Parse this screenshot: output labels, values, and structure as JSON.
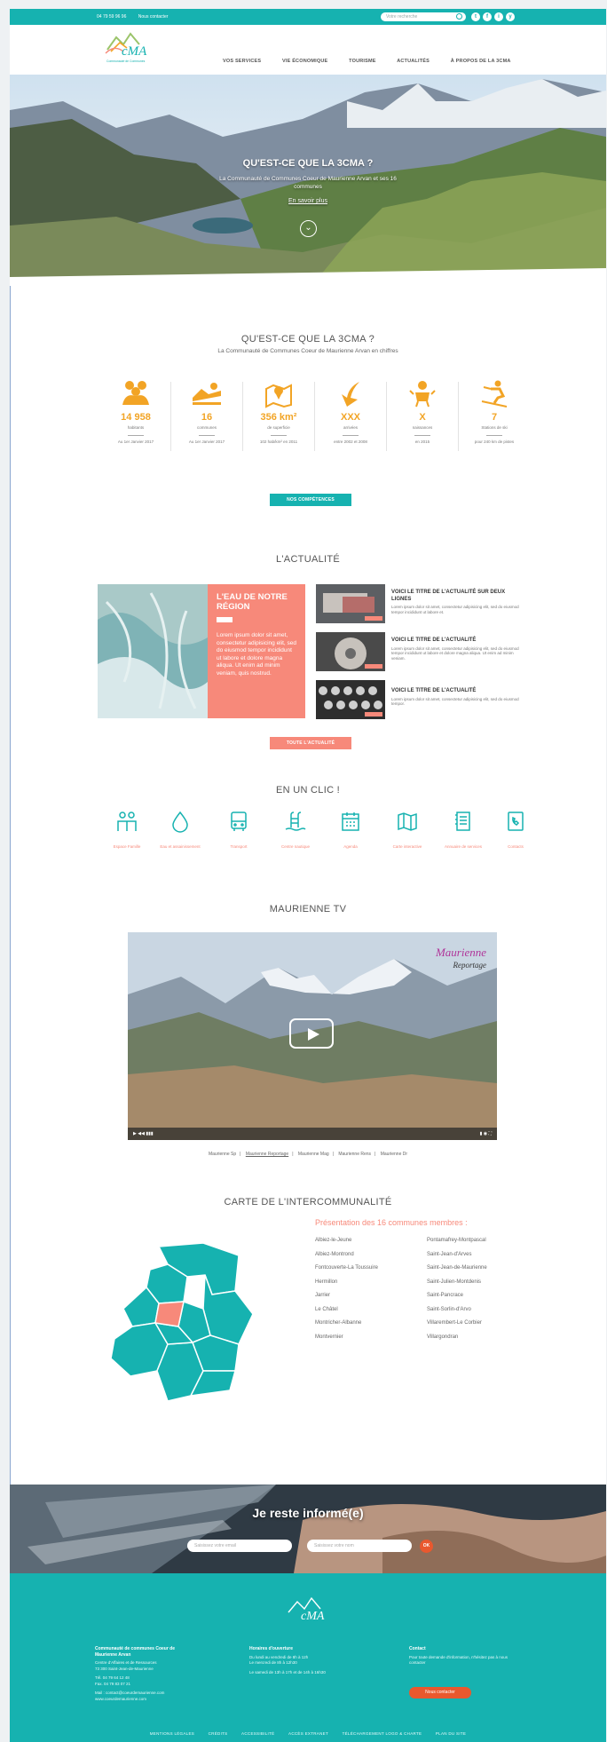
{
  "topbar": {
    "phone": "04 79 59 96 96",
    "contact": "Nous contacter",
    "search_placeholder": "Votre recherche",
    "social": [
      "t",
      "f",
      "i",
      "y"
    ]
  },
  "nav": [
    "VOS SERVICES",
    "VIE ÉCONOMIQUE",
    "TOURISME",
    "ACTUALITÉS",
    "À PROPOS DE LA 3CMA"
  ],
  "logo": {
    "text": "3CMA",
    "tagline": "Communauté de Communes"
  },
  "hero": {
    "title": "QU'EST-CE QUE LA 3CMA ?",
    "subtitle": "La Communauté de Communes Coeur de Maurienne Arvan et ses 16 communes",
    "link": "En savoir plus"
  },
  "about": {
    "title": "QU'EST-CE QUE LA 3CMA ?",
    "subtitle": "La Communauté de Communes Coeur de Maurienne Arvan en chiffres"
  },
  "stats": [
    {
      "icon": "people-icon",
      "value": "14 958",
      "label": "habitants",
      "note": "Au 1er Janvier 2017"
    },
    {
      "icon": "landscape-icon",
      "value": "16",
      "label": "communes",
      "note": "Au 1er Janvier 2017"
    },
    {
      "icon": "map-pin-icon",
      "value": "356 km²",
      "label": "de superficie",
      "note": "102 hab/km² en 2011"
    },
    {
      "icon": "arrow-down-icon",
      "value": "XXX",
      "label": "arrivées",
      "note": "entre 2002 et 2008"
    },
    {
      "icon": "baby-icon",
      "value": "X",
      "label": "naissances",
      "note": "en 2015"
    },
    {
      "icon": "skier-icon",
      "value": "7",
      "label": "Stations de ski",
      "note": "pour 240 km de pistes"
    }
  ],
  "competences_button": "NOS COMPÉTENCES",
  "news": {
    "title": "L'ACTUALITÉ",
    "main_title": "L'EAU DE NOTRE RÉGION",
    "main_text": "Lorem ipsum dolor sit amet, consectetur adipisicing elit, sed do eiusmod tempor incididunt ut labore et dolore magna aliqua. Ut enim ad minim veniam, quis nostrud.",
    "items": [
      {
        "title": "VOICI LE TITRE DE L'ACTUALITÉ SUR DEUX LIGNES",
        "text": "Lorem ipsum dolor sit amet, consectetur adipisicing elit, sed do eiusmod tempor incididunt ut labore et."
      },
      {
        "title": "VOICI LE TITRE DE L'ACTUALITÉ",
        "text": "Lorem ipsum dolor sit amet, consectetur adipisicing elit, sed do eiusmod tempor incididunt ut labore et dolore magna aliqua. Ut enim ad minim veniam."
      },
      {
        "title": "VOICI LE TITRE DE L'ACTUALITÉ",
        "text": "Lorem ipsum dolor sit amet, consectetur adipisicing elit, sed do eiusmod tempor."
      }
    ],
    "all_button": "TOUTE L'ACTUALITÉ"
  },
  "clic": {
    "title": "EN UN CLIC !",
    "items": [
      {
        "icon": "family-icon",
        "label": "Espace Famille"
      },
      {
        "icon": "water-drop-icon",
        "label": "Eau et assainissement"
      },
      {
        "icon": "bus-icon",
        "label": "Transport"
      },
      {
        "icon": "pool-icon",
        "label": "Centre nautique"
      },
      {
        "icon": "calendar-icon",
        "label": "Agenda"
      },
      {
        "icon": "map-icon",
        "label": "Carte interactive"
      },
      {
        "icon": "directory-icon",
        "label": "Annuaire de services"
      },
      {
        "icon": "phone-icon",
        "label": "Contacts"
      }
    ]
  },
  "tv": {
    "title": "MAURIENNE TV",
    "brand": "Maurienne",
    "brand2": "Reportage",
    "links": [
      "Maurienne Sp",
      "Maurienne Reportage",
      "Maurienne Mag",
      "Maurienne Rens",
      "Maurienne Dr"
    ]
  },
  "map": {
    "title": "CARTE DE L'INTERCOMMUNALITÉ",
    "heading": "Présentation des 16 communes membres :",
    "left": [
      "Albiez-le-Jeune",
      "Albiez-Montrond",
      "Fontcouverte-La Toussuire",
      "Hermillon",
      "Jarrier",
      "Le Châtel",
      "Montricher-Albanne",
      "Montvernier"
    ],
    "right": [
      "Pontamafrey-Montpascal",
      "Saint-Jean-d'Arves",
      "Saint-Jean-de-Maurienne",
      "Saint-Julien-Montdenis",
      "Saint-Pancrace",
      "Saint-Sorlin-d'Arvo",
      "Villarembert-Le Corbier",
      "Villargondran"
    ]
  },
  "newsletter": {
    "title": "Je reste informé(e)",
    "email_placeholder": "Saisissez votre email",
    "name_placeholder": "Saisissez votre nom",
    "ok": "OK"
  },
  "footer": {
    "col1": {
      "h": "Communauté de communes Coeur de Maurienne Arvan",
      "lines": [
        "Centre d'Affaires et de Ressources",
        "73 300 Saint-Jean-de-Maurienne",
        "Tél. 04 79 64 12 48",
        "Fax. 04 79 83 07 21",
        "Mail : contact@coeurdemaurienne.com",
        "www.coeurdemaurienne.com"
      ]
    },
    "col2": {
      "h": "Horaires d'ouverture",
      "lines": [
        "Du lundi au vendredi de 8h à 12h",
        "Le mercredi de 8h à 12h30",
        "Le samedi de 13h à 17h et de 14h à 16h30"
      ]
    },
    "col3": {
      "h": "Contact",
      "lines": [
        "Pour toute demande d'information, n'hésitez pas à nous contacter"
      ]
    },
    "button": "Nous contacter",
    "links": [
      "MENTIONS LÉGALES",
      "CRÉDITS",
      "ACCESSIBILITÉ",
      "ACCÈS EXTRANET",
      "TÉLÉCHARGEMENT LOGO & CHARTE",
      "PLAN DU SITE"
    ]
  },
  "colors": {
    "teal": "#16b2b0",
    "orange": "#f2a425",
    "coral": "#f7897a",
    "red": "#e9582e"
  }
}
